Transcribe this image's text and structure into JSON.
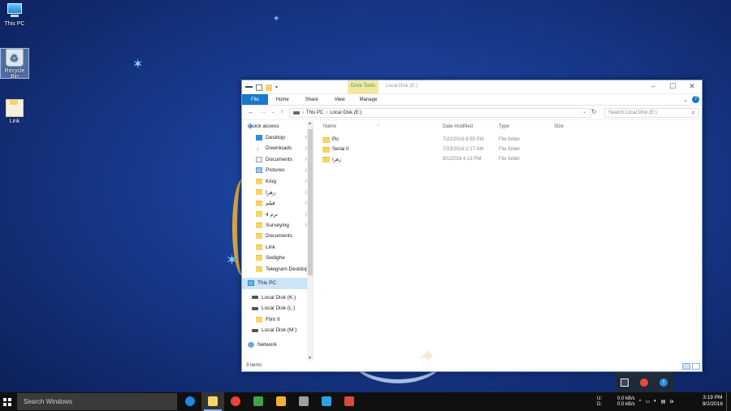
{
  "desktop": {
    "icons": [
      {
        "label": "This PC",
        "icon": "this-pc-icon"
      },
      {
        "label": "Recycle Bin",
        "icon": "recycle-bin-icon"
      },
      {
        "label": "Link",
        "icon": "folder-shortcut-icon"
      }
    ]
  },
  "window": {
    "title": "Local Disk (E:)",
    "contextual_tab": "Drive Tools",
    "accent": "#1979ca",
    "ribbon_tabs": [
      "File",
      "Home",
      "Share",
      "View",
      "Manage"
    ],
    "address": {
      "crumbs": [
        "This PC",
        "Local Disk (E:)"
      ],
      "search_placeholder": "Search Local Disk (E:)"
    },
    "nav_pane": [
      {
        "label": "Quick access",
        "icon": "star-icon",
        "pinned": false
      },
      {
        "label": "Desktop",
        "icon": "desktop-icon",
        "pinned": true
      },
      {
        "label": "Downloads",
        "icon": "downloads-icon",
        "pinned": true
      },
      {
        "label": "Documents",
        "icon": "documents-icon",
        "pinned": true
      },
      {
        "label": "Pictures",
        "icon": "pictures-icon",
        "pinned": true
      },
      {
        "label": "King",
        "icon": "folder-icon",
        "pinned": true
      },
      {
        "label": "زهرا",
        "icon": "folder-icon",
        "pinned": true
      },
      {
        "label": "فیلم",
        "icon": "folder-icon",
        "pinned": true
      },
      {
        "label": "ترم 4",
        "icon": "folder-icon",
        "pinned": true
      },
      {
        "label": "Surveying",
        "icon": "folder-icon",
        "pinned": true
      },
      {
        "label": "Documents",
        "icon": "folder-icon",
        "pinned": false
      },
      {
        "label": "Link",
        "icon": "folder-icon",
        "pinned": false
      },
      {
        "label": "Sedighe",
        "icon": "folder-icon",
        "pinned": false
      },
      {
        "label": "Telegram Desktop",
        "icon": "folder-icon",
        "pinned": false
      },
      {
        "label": "This PC",
        "icon": "this-pc-icon",
        "pinned": false,
        "selected": true
      },
      {
        "label": "Local Disk (K:)",
        "icon": "drive-icon",
        "pinned": false
      },
      {
        "label": "Local Disk (L:)",
        "icon": "drive-icon",
        "pinned": false
      },
      {
        "label": "Film II",
        "icon": "folder-icon",
        "pinned": false
      },
      {
        "label": "Local Disk (M:)",
        "icon": "drive-icon",
        "pinned": false
      },
      {
        "label": "Network",
        "icon": "network-icon",
        "pinned": false
      }
    ],
    "columns": {
      "name": "Name",
      "date": "Date modified",
      "type": "Type",
      "size": "Size"
    },
    "files": [
      {
        "name": "Pic",
        "date": "7/22/2016 6:55 PM",
        "type": "File folder",
        "size": ""
      },
      {
        "name": "Serial II",
        "date": "7/23/2016 2:17 AM",
        "type": "File folder",
        "size": ""
      },
      {
        "name": "زهرا",
        "date": "9/1/2016 4:13 PM",
        "type": "File folder",
        "size": ""
      }
    ],
    "status": "3 items"
  },
  "taskbar": {
    "search_placeholder": "Search Windows",
    "apps": [
      {
        "name": "edge-icon",
        "color": "#1e88e5"
      },
      {
        "name": "file-explorer-icon",
        "color": "#f7d56a",
        "active": true
      },
      {
        "name": "chrome-icon",
        "color": "#e94235"
      },
      {
        "name": "internet-download-manager-icon",
        "color": "#43a047"
      },
      {
        "name": "sticky-app-icon",
        "color": "#f2b233"
      },
      {
        "name": "media-app-icon",
        "color": "#9e9e9e"
      },
      {
        "name": "telegram-icon",
        "color": "#2aa3e0"
      },
      {
        "name": "monitor-app-icon",
        "color": "#d94a3a"
      }
    ],
    "net_labels": {
      "up": "U:",
      "down": "D:"
    },
    "net_speed": {
      "up": "0.0 kB/s",
      "down": "0.0 kB/s"
    },
    "language": "فا",
    "time": "3:19 PM",
    "date": "9/2/2016"
  }
}
